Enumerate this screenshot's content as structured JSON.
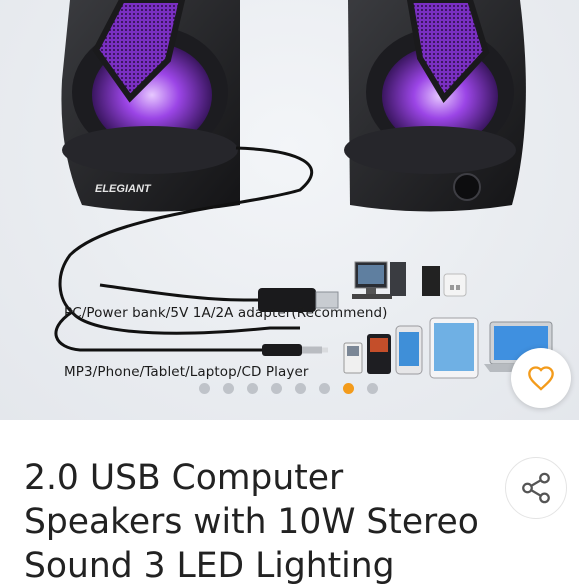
{
  "gallery": {
    "brand": "ELEGIANT",
    "caption_power": "PC/Power bank/5V 1A/2A adapter(Recommend)",
    "caption_audio": "MP3/Phone/Tablet/Laptop/CD Player",
    "slides_total": 8,
    "active_slide": 7
  },
  "product": {
    "title": "2.0 USB Computer Speakers with 10W Stereo Sound 3 LED Lighting"
  },
  "icons": {
    "favorite": "heart-outline-icon",
    "share": "share-icon"
  },
  "colors": {
    "accent": "#f39b1b",
    "dot_inactive": "#bfc3c9",
    "text": "#222222"
  }
}
